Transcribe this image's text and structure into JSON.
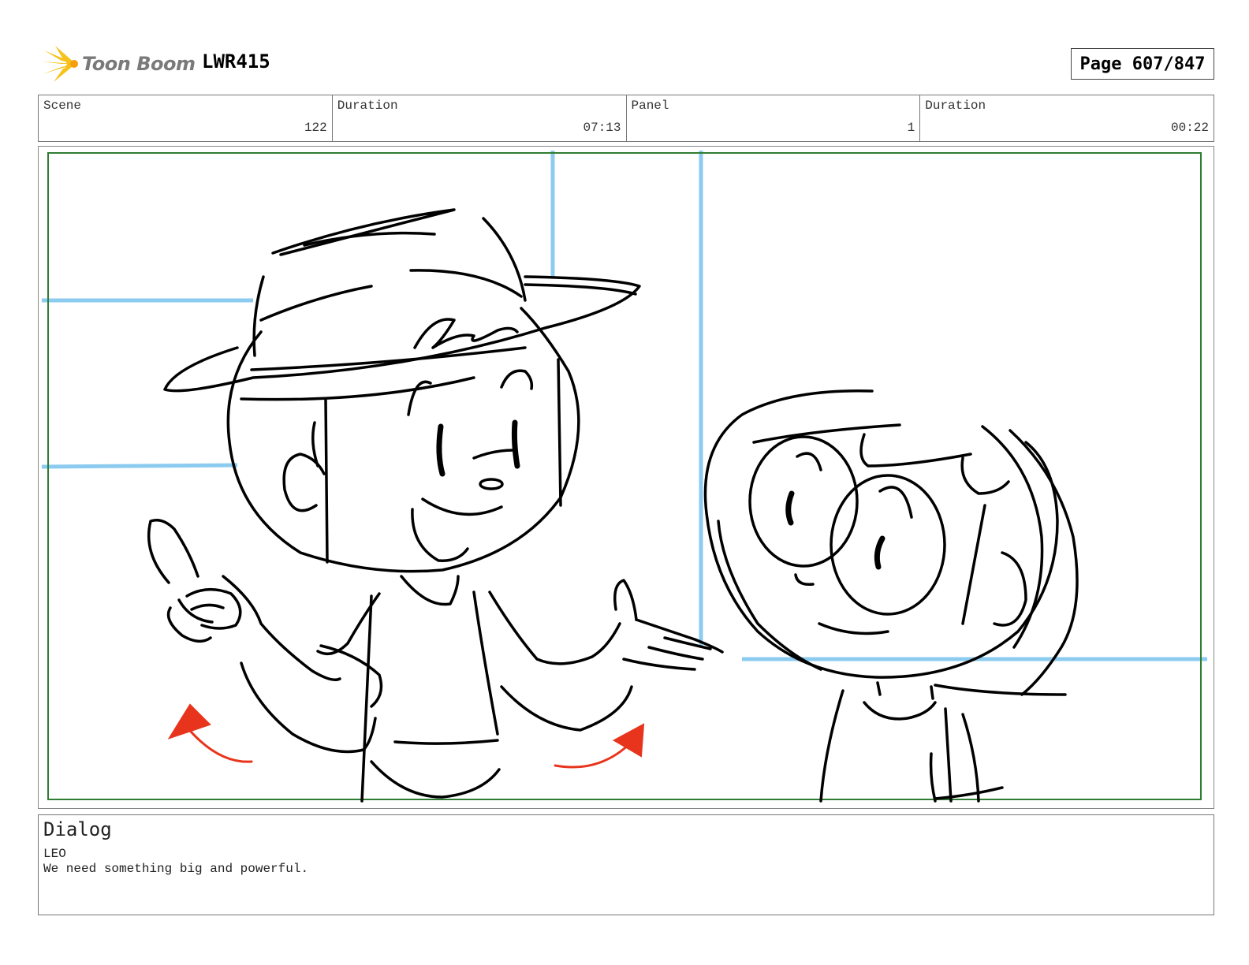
{
  "header": {
    "logo_text": "Toon Boom",
    "project_code": "LWR415",
    "page_label": "Page 607/847"
  },
  "info": [
    {
      "label": "Scene",
      "value": "122"
    },
    {
      "label": "Duration",
      "value": "07:13"
    },
    {
      "label": "Panel",
      "value": "1"
    },
    {
      "label": "Duration",
      "value": "00:22"
    }
  ],
  "dialog": {
    "title": "Dialog",
    "character": "LEO",
    "line": "We need something big and powerful."
  },
  "colors": {
    "safe_frame": "#2e7d32",
    "layout_lines": "#8ccbf0",
    "sketch": "#000000",
    "motion_arrows": "#e8341c",
    "logo_star": "#f7c21b"
  }
}
